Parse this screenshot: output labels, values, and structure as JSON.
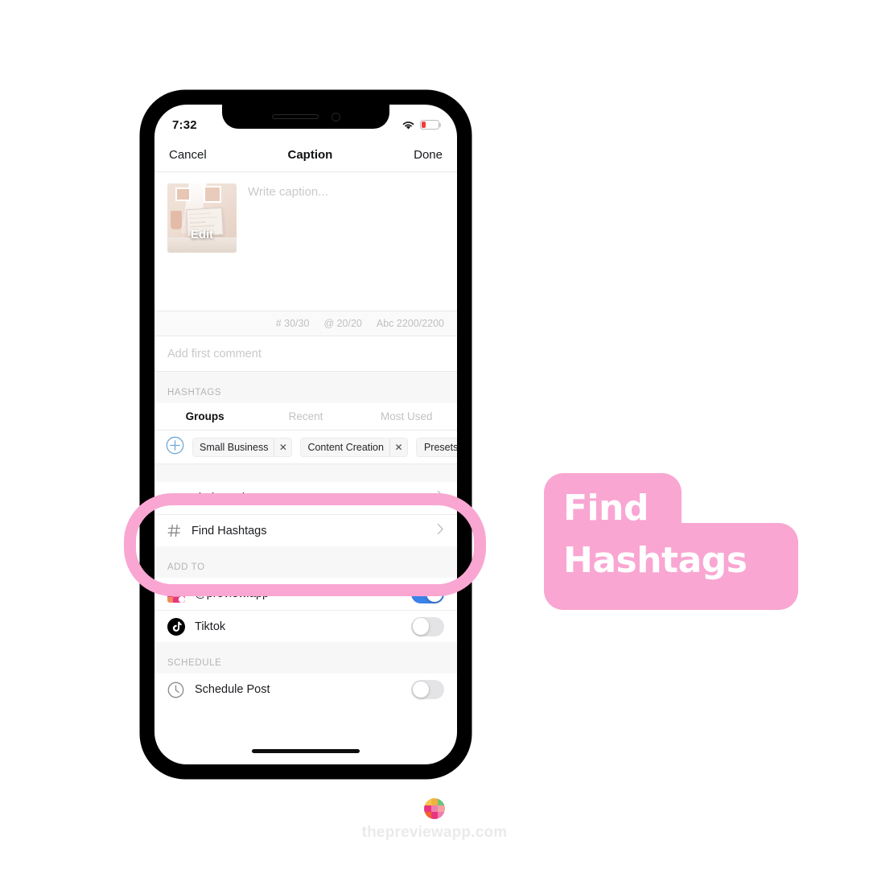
{
  "phone": {
    "statusbar": {
      "time": "7:32",
      "wifi_icon": "wifi-icon",
      "battery_icon": "battery-low-icon"
    },
    "navbar": {
      "cancel": "Cancel",
      "title": "Caption",
      "done": "Done"
    },
    "caption": {
      "thumbnail_edit_label": "Edit",
      "placeholder": "Write caption...",
      "counters": [
        "# 30/30",
        "@ 20/20",
        "Abc 2200/2200"
      ],
      "first_comment_placeholder": "Add first comment"
    },
    "hashtags": {
      "section_label": "HASHTAGS",
      "tabs": [
        {
          "label": "Groups",
          "active": true
        },
        {
          "label": "Recent",
          "active": false
        },
        {
          "label": "Most Used",
          "active": false
        }
      ],
      "add_group_icon": "plus-circle-icon",
      "chips": [
        {
          "label": "Small Business",
          "close_icon": "close-icon"
        },
        {
          "label": "Content Creation",
          "close_icon": "close-icon"
        },
        {
          "label": "Presets",
          "close_icon": ""
        }
      ]
    },
    "actions": [
      {
        "label": "Find Captions",
        "icon": "text-lines-icon",
        "chevron": "chevron-right-icon"
      },
      {
        "label": "Find Hashtags",
        "icon": "hashtag-icon",
        "chevron": "chevron-right-icon"
      }
    ],
    "add_to": {
      "section_label": "ADD TO",
      "items": [
        {
          "label": "@preview.app",
          "icon": "preview-app-icon",
          "toggle": "on"
        },
        {
          "label": "Tiktok",
          "icon": "tiktok-icon",
          "toggle": "off"
        }
      ]
    },
    "schedule": {
      "section_label": "SCHEDULE",
      "items": [
        {
          "label": "Schedule Post",
          "icon": "clock-icon",
          "toggle": "off"
        }
      ]
    }
  },
  "callout": {
    "line1": "Find",
    "line2": "Hashtags",
    "color": "#f9a6d2"
  },
  "highlight": {
    "color": "#f9a6d2"
  },
  "footer": {
    "logo_icon": "preview-app-logo-icon",
    "site": "thepreviewapp.com"
  },
  "colors": {
    "accent_pink": "#f9a6d2",
    "toggle_on": "#3b82e8",
    "toggle_off": "#e4e4e6",
    "battery_red": "#f43b3b",
    "text_dark": "#1b1d20",
    "text_muted": "#c2c2c2"
  }
}
